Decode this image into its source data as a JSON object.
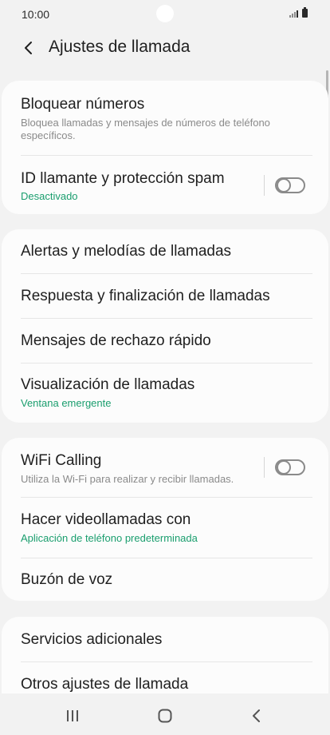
{
  "status_bar": {
    "time": "10:00"
  },
  "header": {
    "title": "Ajustes de llamada",
    "back_icon": "chevron-left-icon"
  },
  "groups": [
    {
      "items": [
        {
          "title": "Bloquear números",
          "subtitle": "Bloquea llamadas y mensajes de números de teléfono específicos.",
          "subtitle_style": "secondary"
        },
        {
          "title": "ID llamante y protección spam",
          "subtitle": "Desactivado",
          "subtitle_style": "accent",
          "toggle": false
        }
      ]
    },
    {
      "items": [
        {
          "title": "Alertas y melodías de llamadas"
        },
        {
          "title": "Respuesta y finalización de llamadas"
        },
        {
          "title": "Mensajes de rechazo rápido"
        },
        {
          "title": "Visualización de llamadas",
          "subtitle": "Ventana emergente",
          "subtitle_style": "accent"
        }
      ]
    },
    {
      "items": [
        {
          "title": "WiFi Calling",
          "subtitle": "Utiliza la Wi-Fi para realizar y recibir llamadas.",
          "subtitle_style": "secondary",
          "toggle": false
        },
        {
          "title": "Hacer videollamadas con",
          "subtitle": "Aplicación de teléfono predeterminada",
          "subtitle_style": "accent"
        },
        {
          "title": "Buzón de voz"
        }
      ]
    },
    {
      "items": [
        {
          "title": "Servicios adicionales"
        },
        {
          "title": "Otros ajustes de llamada"
        }
      ]
    }
  ],
  "nav_bar": {
    "recents_icon": "recents-icon",
    "home_icon": "home-icon",
    "back_icon": "back-icon"
  },
  "colors": {
    "background": "#f2f2f2",
    "card": "#fcfcfc",
    "accent": "#1a9e6e",
    "secondary_text": "#8a8a8a"
  }
}
